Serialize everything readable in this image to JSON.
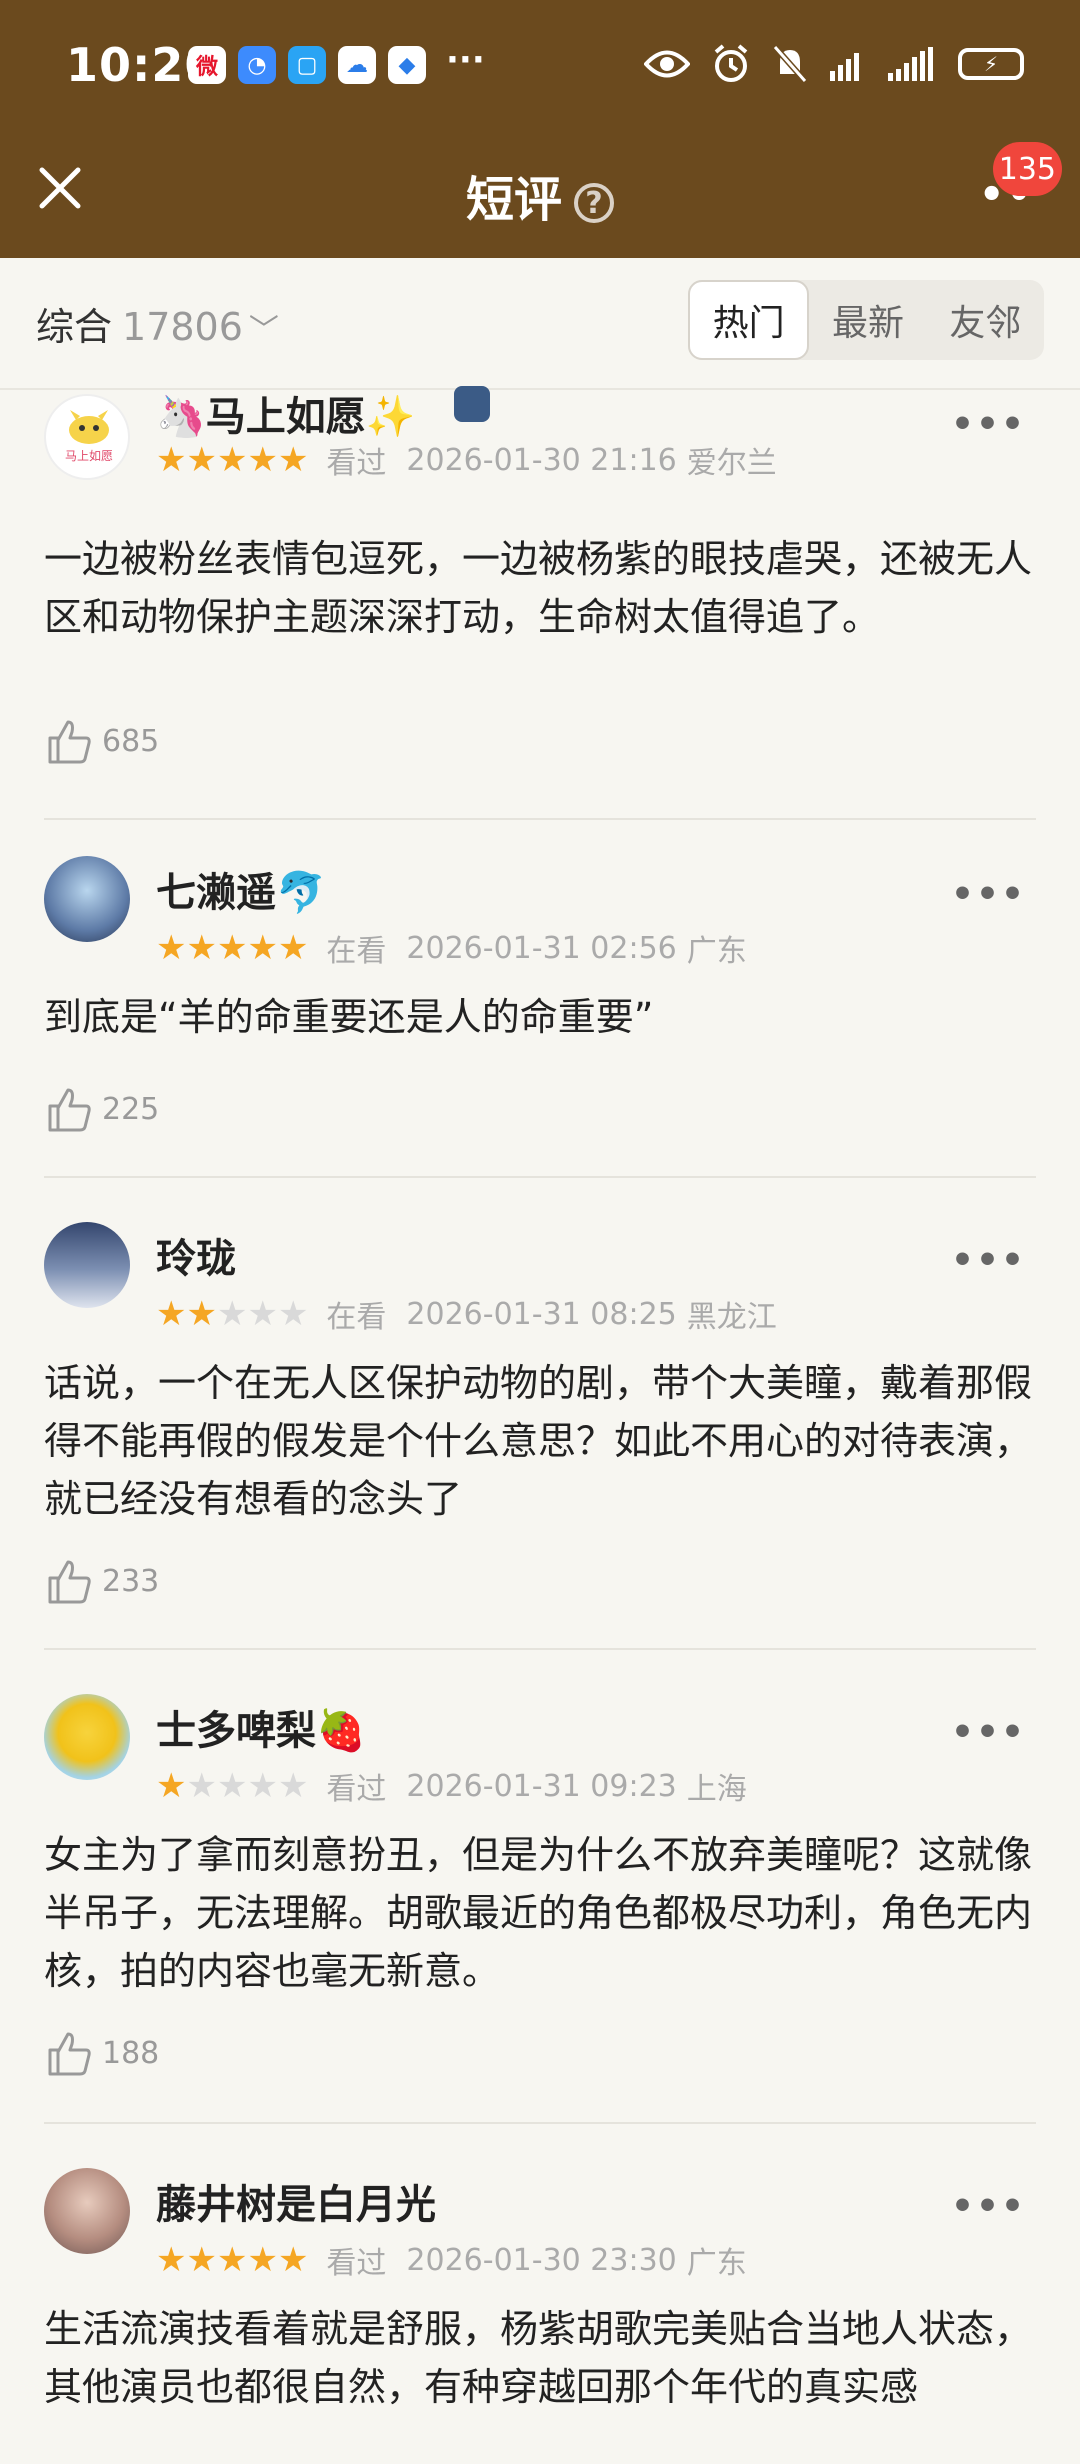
{
  "status_bar": {
    "time": "10:20",
    "app_icons": [
      "weibo-icon",
      "bulb-icon",
      "chat-icon",
      "cloud-icon",
      "browser-icon"
    ],
    "more": "···",
    "battery": "⚡"
  },
  "header": {
    "title": "短评",
    "help": "?",
    "more": "••",
    "badge": "135",
    "bg_color": "#6b4a1e"
  },
  "filter": {
    "sort_label": "综合",
    "count": "17806",
    "tabs": [
      {
        "label": "热门",
        "active": true
      },
      {
        "label": "最新",
        "active": false
      },
      {
        "label": "友邻",
        "active": false
      }
    ]
  },
  "reviews": [
    {
      "name": "🦄马上如愿✨",
      "rating": 5,
      "status": "看过",
      "datetime": "2026-01-30 21:16",
      "location": "爱尔兰",
      "content": "一边被粉丝表情包逗死，一边被杨紫的眼技虐哭，还被无人区和动物保护主题深深打动，生命树太值得追了。",
      "likes": "685",
      "avatar_text": "马上如愿"
    },
    {
      "name": "七濑遥🐬",
      "rating": 5,
      "status": "在看",
      "datetime": "2026-01-31 02:56",
      "location": "广东",
      "content": "到底是“羊的命重要还是人的命重要”",
      "likes": "225"
    },
    {
      "name": "玲珑",
      "rating": 2,
      "status": "在看",
      "datetime": "2026-01-31 08:25",
      "location": "黑龙江",
      "content": "话说，一个在无人区保护动物的剧，带个大美瞳，戴着那假得不能再假的假发是个什么意思？如此不用心的对待表演，就已经没有想看的念头了",
      "likes": "233"
    },
    {
      "name": "士多啤梨🍓",
      "rating": 1,
      "status": "看过",
      "datetime": "2026-01-31 09:23",
      "location": "上海",
      "content": "女主为了拿而刻意扮丑，但是为什么不放弃美瞳呢？这就像半吊子，无法理解。胡歌最近的角色都极尽功利，角色无内核，拍的内容也毫无新意。",
      "likes": "188"
    },
    {
      "name": "藤井树是白月光",
      "rating": 5,
      "status": "看过",
      "datetime": "2026-01-30 23:30",
      "location": "广东",
      "content": "生活流演技看着就是舒服，杨紫胡歌完美贴合当地人状态，其他演员也都很自然，有种穿越回那个年代的真实感",
      "likes": ""
    }
  ]
}
